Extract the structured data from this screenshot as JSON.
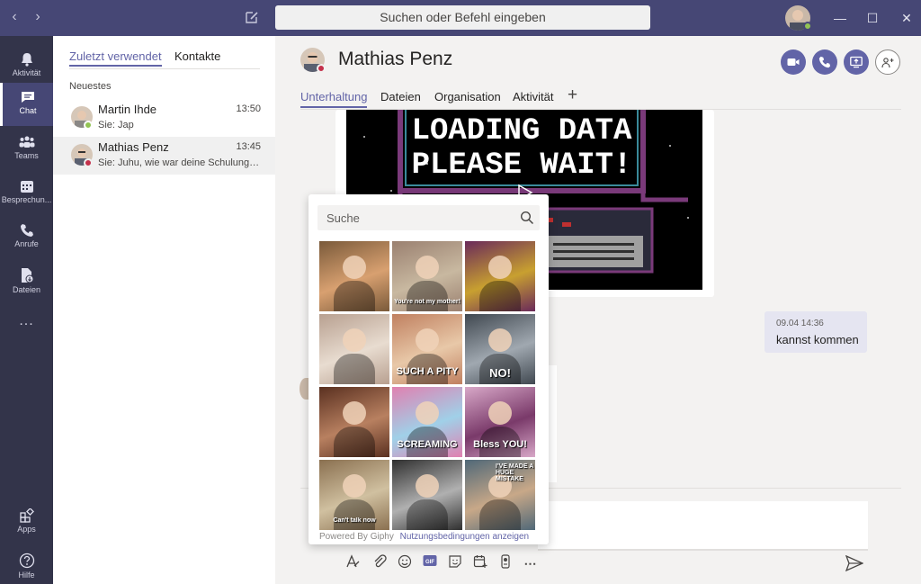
{
  "window": {
    "search_placeholder": "Suchen oder Befehl eingeben",
    "back_icon": "chevron-left-icon",
    "forward_icon": "chevron-right-icon"
  },
  "rail": {
    "items": [
      {
        "label": "Aktivität",
        "icon": "bell-icon"
      },
      {
        "label": "Chat",
        "icon": "chat-icon"
      },
      {
        "label": "Teams",
        "icon": "teams-icon"
      },
      {
        "label": "Besprechun...",
        "icon": "calendar-icon"
      },
      {
        "label": "Anrufe",
        "icon": "phone-icon"
      },
      {
        "label": "Dateien",
        "icon": "files-icon"
      },
      {
        "label": "...",
        "icon": "more-icon"
      }
    ],
    "bottom": [
      {
        "label": "Apps",
        "icon": "apps-icon"
      },
      {
        "label": "Hilfe",
        "icon": "help-icon"
      }
    ]
  },
  "chatlist": {
    "tabs": [
      "Zuletzt verwendet",
      "Kontakte"
    ],
    "section": "Neuestes",
    "chats": [
      {
        "name": "Martin Ihde",
        "time": "13:50",
        "preview": "Sie: Jap",
        "status_color": "#92c353"
      },
      {
        "name": "Mathias Penz",
        "time": "13:45",
        "preview": "Sie: Juhu, wie war deine Schulung? Ic...",
        "status_color": "#c4314b"
      }
    ]
  },
  "conversation": {
    "title": "Mathias Penz",
    "tabs": [
      "Unterhaltung",
      "Dateien",
      "Organisation",
      "Aktivität",
      "+"
    ],
    "gif_text": [
      "LOADING DATA",
      "PLEASE WAIT!"
    ],
    "message": {
      "time": "09.04 14:36",
      "text": "kannst kommen"
    }
  },
  "picker": {
    "search_placeholder": "Suche",
    "gifs": [
      {
        "caption": "",
        "colors": [
          "#7a5a3a",
          "#d8a070"
        ]
      },
      {
        "caption": "You're not my mother!",
        "colors": [
          "#9a8070",
          "#c8b8a0"
        ]
      },
      {
        "caption": "",
        "colors": [
          "#6a2a5a",
          "#c8a030"
        ]
      },
      {
        "caption": "",
        "colors": [
          "#b8a090",
          "#e8dcd0"
        ]
      },
      {
        "caption": "SUCH A PITY",
        "colors": [
          "#c08060",
          "#e8c8a8"
        ]
      },
      {
        "caption": "NO!",
        "colors": [
          "#404850",
          "#a0a8b0"
        ]
      },
      {
        "caption": "",
        "colors": [
          "#5a3020",
          "#b88060"
        ]
      },
      {
        "caption": "SCREAMING",
        "colors": [
          "#e080b0",
          "#a0d0e8"
        ]
      },
      {
        "caption": "Bless YOU!",
        "colors": [
          "#d8a8c8",
          "#7a3a6a"
        ]
      },
      {
        "caption": "Can't talk now",
        "colors": [
          "#8a7050",
          "#d0c0a0"
        ]
      },
      {
        "caption": "",
        "colors": [
          "#303030",
          "#b0b0b0"
        ]
      },
      {
        "caption": "I'VE MADE A HUGE MISTAKE",
        "colors": [
          "#506878",
          "#c8a888"
        ]
      }
    ],
    "footer_text": "Powered By Giphy",
    "footer_link": "Nutzungsbedingungen anzeigen"
  }
}
